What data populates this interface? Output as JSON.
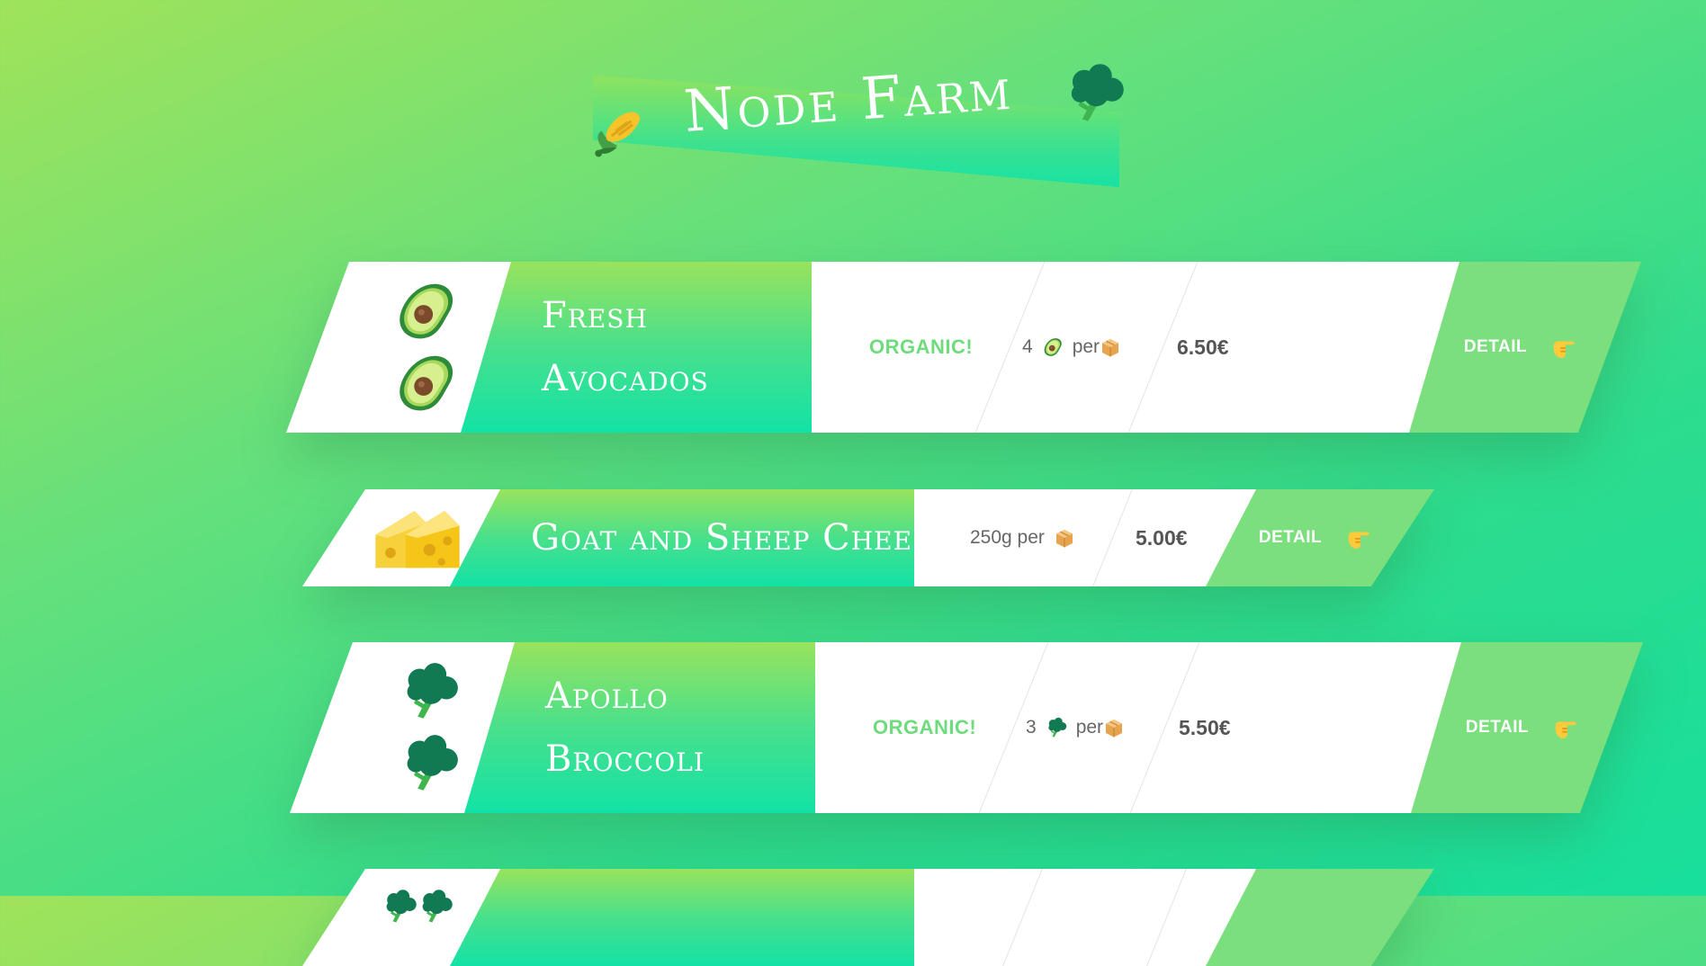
{
  "header": {
    "title": "Node Farm",
    "left_icon": "corn-icon",
    "right_icon": "broccoli-icon"
  },
  "products": [
    {
      "emoji": "avocado-icon",
      "name_line1": "Fresh",
      "name_line2": "Avocados",
      "organic": "ORGANIC!",
      "qty_prefix": "4",
      "qty_suffix": "per",
      "price": "6.50€",
      "detail": "DETAIL"
    },
    {
      "emoji": "cheese-icon",
      "name_line1": "Goat and Sheep Cheese",
      "qty_prefix": "250g per",
      "price": "5.00€",
      "detail": "DETAIL"
    },
    {
      "emoji": "broccoli-icon",
      "name_line1": "Apollo",
      "name_line2": "Broccoli",
      "organic": "ORGANIC!",
      "qty_prefix": "3",
      "qty_suffix": "per",
      "price": "5.50€",
      "detail": "DETAIL"
    }
  ],
  "colors": {
    "accent": "#7adf7c",
    "organic_text": "#6edb7c",
    "name_gradient_top": "#98e35d",
    "name_gradient_bottom": "#12e2a6"
  }
}
